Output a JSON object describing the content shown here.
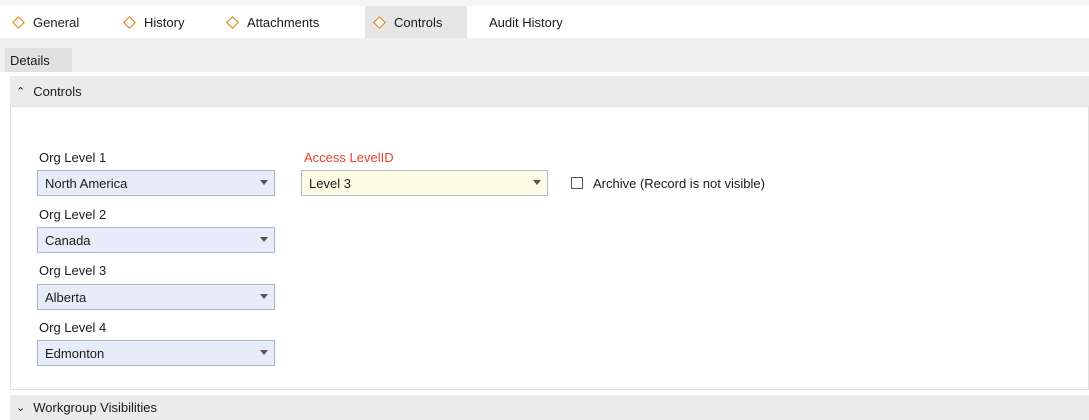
{
  "tabs": [
    {
      "label": "General",
      "icon": "diamond-icon"
    },
    {
      "label": "History",
      "icon": "diamond-icon"
    },
    {
      "label": "Attachments",
      "icon": "diamond-icon"
    },
    {
      "label": "Controls",
      "icon": "diamond-icon",
      "active": true
    },
    {
      "label": "Audit History"
    }
  ],
  "subtab": {
    "label": "Details"
  },
  "sections": {
    "controls": {
      "title": "Controls",
      "expanded": true
    },
    "workgroup": {
      "title": "Workgroup Visibilities",
      "expanded": false
    }
  },
  "fields": {
    "org1": {
      "label": "Org Level 1",
      "value": "North America"
    },
    "org2": {
      "label": "Org Level 2",
      "value": "Canada"
    },
    "org3": {
      "label": "Org Level 3",
      "value": "Alberta"
    },
    "org4": {
      "label": "Org Level 4",
      "value": "Edmonton"
    },
    "access": {
      "label": "Access LevelID",
      "value": "Level 3",
      "required": true
    },
    "archive": {
      "label": "Archive (Record is not visible)",
      "checked": false
    }
  },
  "colors": {
    "accent": "#e07b00",
    "required": "#e8412a",
    "combo_bg": "#e6ecf8"
  }
}
